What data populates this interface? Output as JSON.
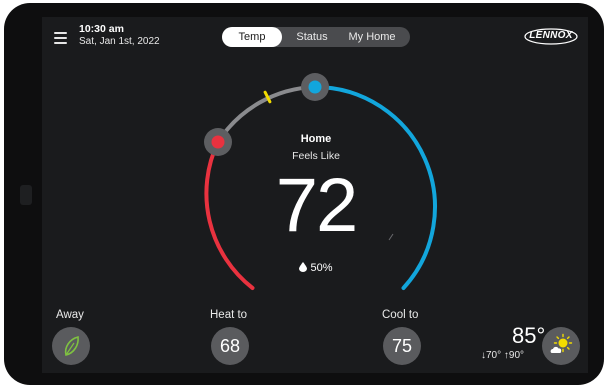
{
  "header": {
    "time": "10:30 am",
    "date": "Sat, Jan 1st, 2022",
    "tabs": [
      {
        "label": "Temp",
        "active": true
      },
      {
        "label": "Status",
        "active": false
      },
      {
        "label": "My Home",
        "active": false
      }
    ],
    "brand": "LENNOX"
  },
  "dial": {
    "mode_label": "Home",
    "feels_like_label": "Feels Like",
    "temperature": "72",
    "humidity": "50%",
    "heat_setpoint": 68,
    "cool_setpoint": 75,
    "colors": {
      "heat": "#e9323f",
      "cool": "#12a6dc",
      "neutral": "#8a8b8e",
      "marker": "#f2dc00"
    }
  },
  "controls": {
    "away_label": "Away",
    "heat_label": "Heat to",
    "heat_value": "68",
    "cool_label": "Cool to",
    "cool_value": "75"
  },
  "outdoor": {
    "temperature": "85°",
    "low": "↓70°",
    "high": "↑90°",
    "weather_icon": "partly-sunny-icon"
  }
}
